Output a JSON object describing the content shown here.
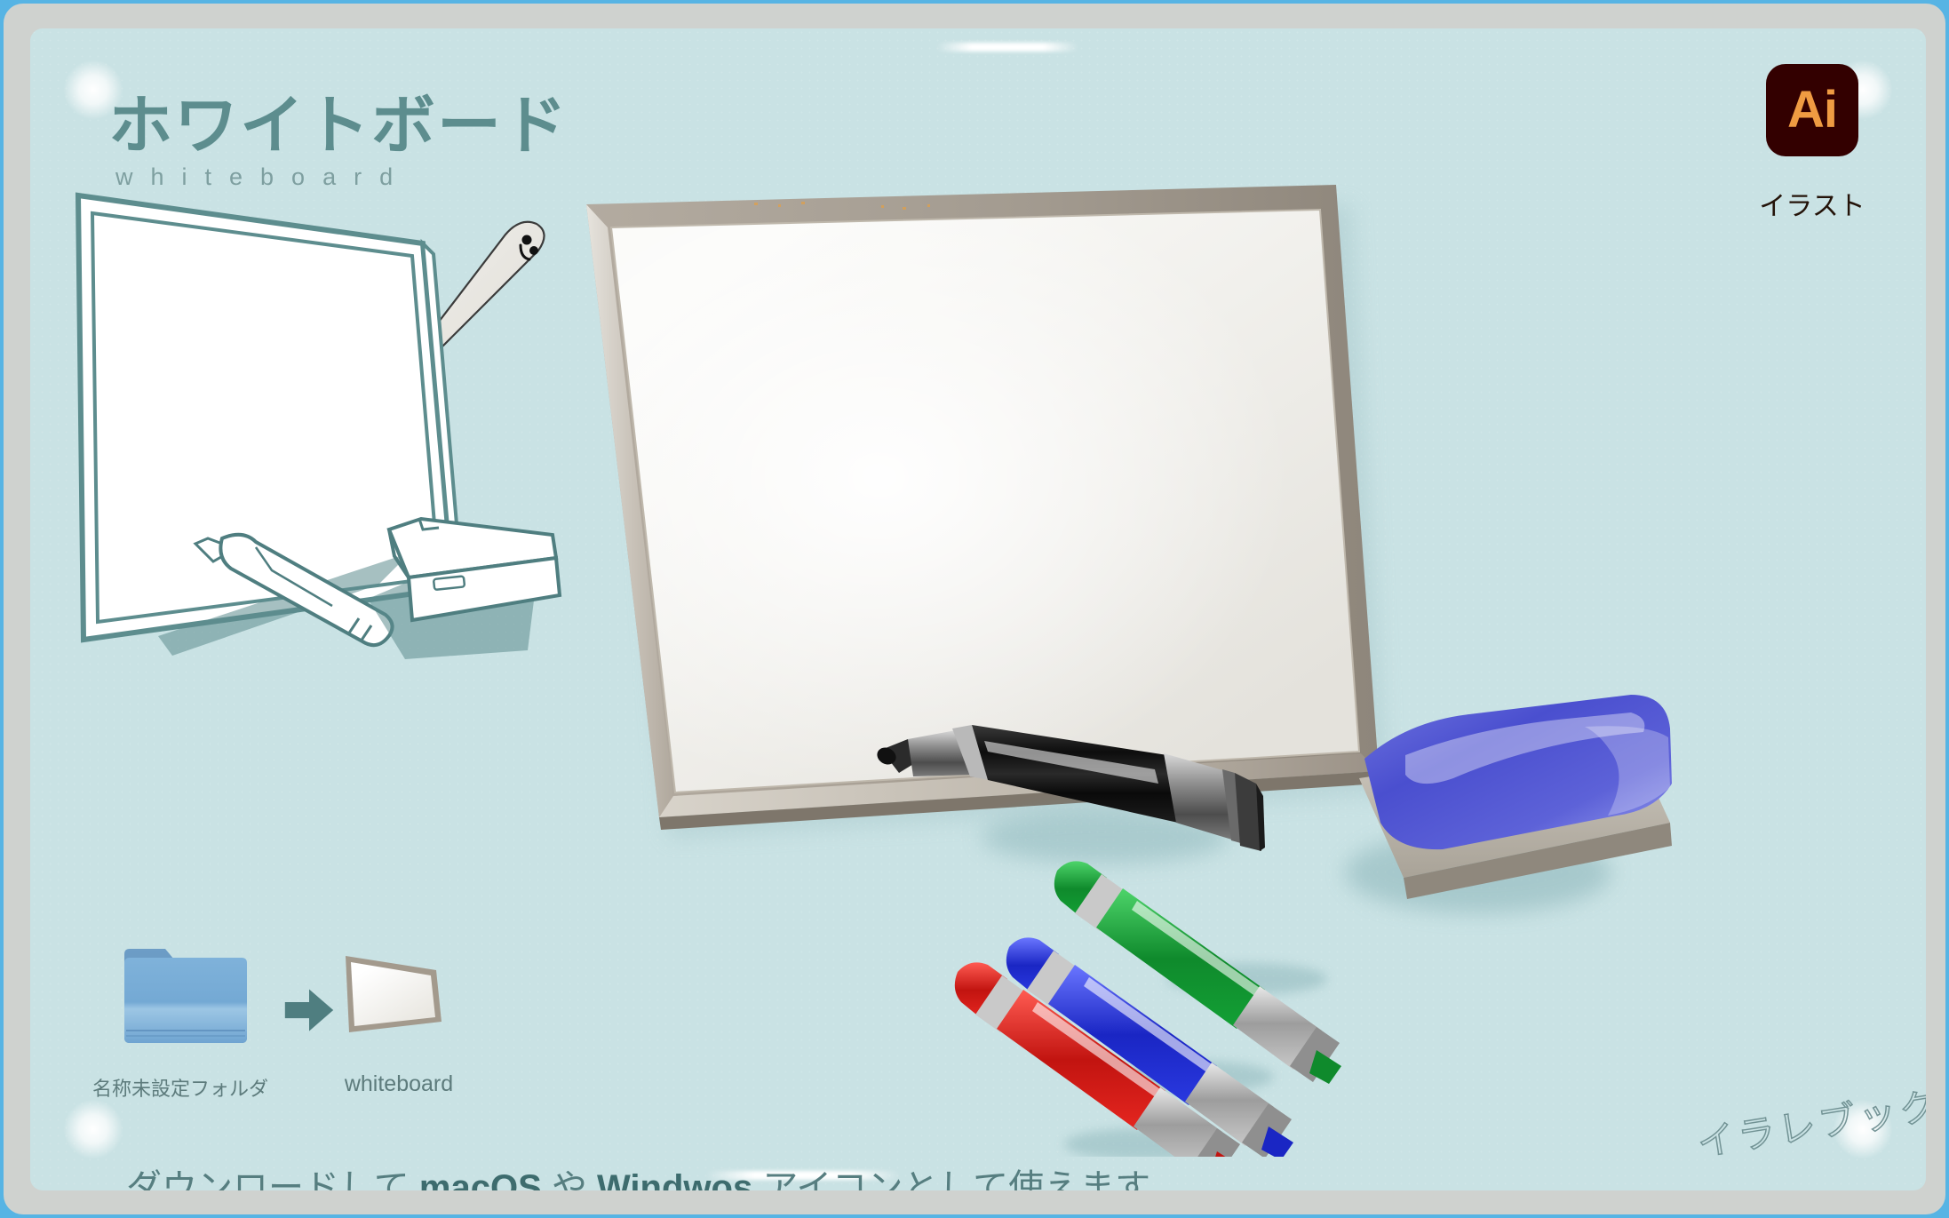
{
  "page": {
    "title_jp": "ホワイトボード",
    "subtitle_en": "whiteboard",
    "caption_prefix": "ダウンロードして ",
    "caption_os1": "macOS",
    "caption_mid": " や ",
    "caption_os2": "Windwos",
    "caption_suffix": " アイコンとして使えます",
    "watermark": "イラレブック"
  },
  "badge": {
    "app_glyph": "Ai",
    "app_label": "イラスト",
    "badge_bg": "#330000",
    "glyph_color": "#ef9b42"
  },
  "icons": {
    "folder_label": "名称未設定フォルダ",
    "board_label": "whiteboard",
    "arrow_name": "arrow-right-icon"
  },
  "colors": {
    "outer_edge": "#57b4e4",
    "frame": "#cfd2cf",
    "panel_bg": "#c9e2e4",
    "accent_teal": "#5d8d8e",
    "board_frame": "#9d958a",
    "board_surface": "#f4f3ef",
    "marker_black": "#141414",
    "marker_green": "#179b37",
    "marker_blue": "#2337d8",
    "marker_red": "#e01b17",
    "eraser_blue": "#4a4fcf",
    "folder_blue": "#6fa8d5"
  },
  "illustration": {
    "left_art_name": "whiteboard-line-art",
    "right_art_name": "whiteboard-rendered",
    "stylus_name": "stylus-with-face",
    "eraser_name": "whiteboard-eraser",
    "markers": [
      "green-marker",
      "blue-marker",
      "red-marker",
      "black-marker"
    ]
  }
}
